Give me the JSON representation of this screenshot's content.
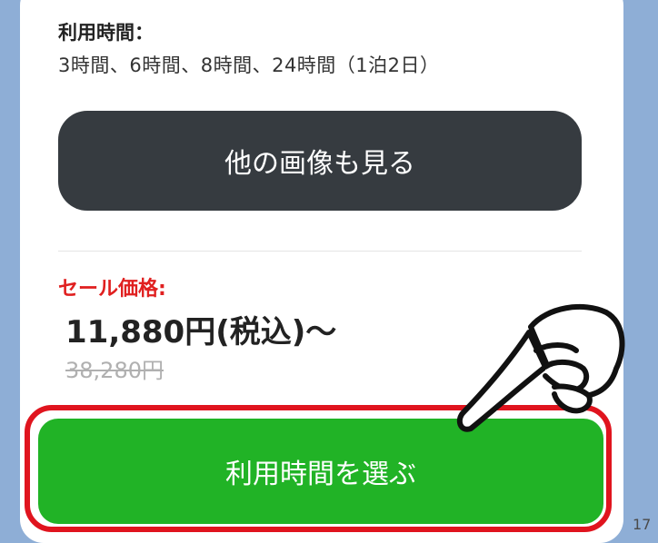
{
  "usage": {
    "label": "利用時間：",
    "value": "3時間、6時間、8時間、24時間（1泊2日）"
  },
  "more_images_button": {
    "label": "他の画像も見る"
  },
  "sale": {
    "label": "セール価格:",
    "price": "11,880円(税込)〜",
    "original_price": "38,280円"
  },
  "select_button": {
    "label": "利用時間を選ぶ"
  },
  "page_number": "17",
  "icons": {
    "pointer": "pointing-hand-icon"
  },
  "colors": {
    "sale_label": "#e02020",
    "select_button": "#21b326",
    "more_button": "#363b40",
    "highlight_frame": "#e0141e"
  }
}
